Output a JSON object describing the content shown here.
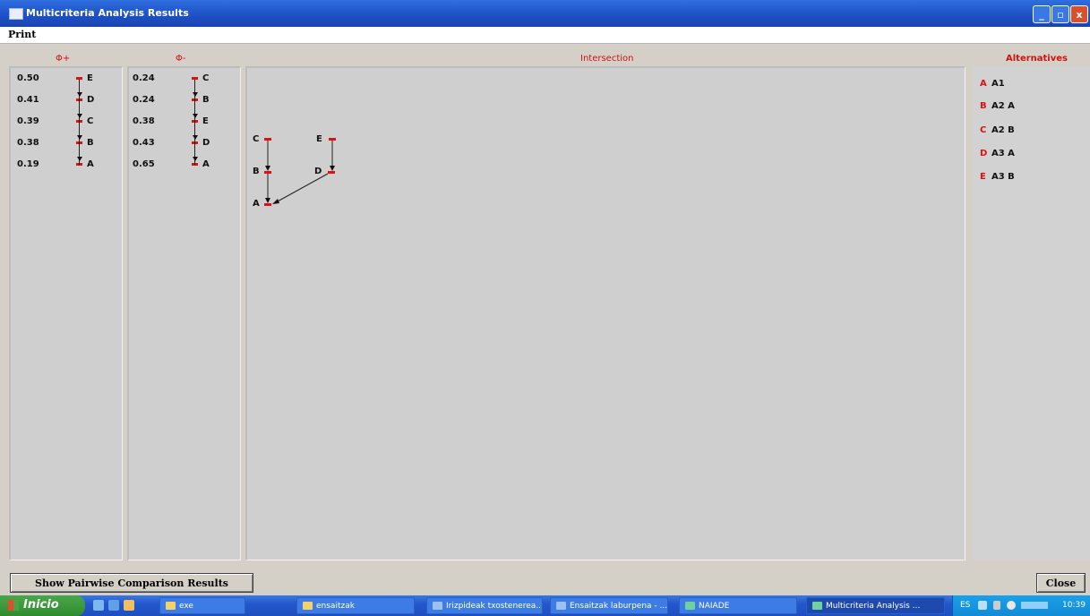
{
  "window": {
    "title": "Multicriteria Analysis Results",
    "min": "_",
    "max": "▫",
    "close": "x"
  },
  "menu": {
    "print": "Print"
  },
  "headers": {
    "phi_plus": "Φ+",
    "phi_minus": "Φ-",
    "intersection": "Intersection",
    "alternatives": "Alternatives"
  },
  "phi_plus": [
    {
      "value": "0.50",
      "label": "E"
    },
    {
      "value": "0.41",
      "label": "D"
    },
    {
      "value": "0.39",
      "label": "C"
    },
    {
      "value": "0.38",
      "label": "B"
    },
    {
      "value": "0.19",
      "label": "A"
    }
  ],
  "phi_minus": [
    {
      "value": "0.24",
      "label": "C"
    },
    {
      "value": "0.24",
      "label": "B"
    },
    {
      "value": "0.38",
      "label": "E"
    },
    {
      "value": "0.43",
      "label": "D"
    },
    {
      "value": "0.65",
      "label": "A"
    }
  ],
  "intersection": {
    "nodes": [
      "C",
      "E",
      "B",
      "D",
      "A"
    ]
  },
  "alternatives": [
    {
      "letter": "A",
      "name": "A1"
    },
    {
      "letter": "B",
      "name": "A2  A"
    },
    {
      "letter": "C",
      "name": "A2  B"
    },
    {
      "letter": "D",
      "name": "A3  A"
    },
    {
      "letter": "E",
      "name": "A3  B"
    }
  ],
  "buttons": {
    "pairwise": "Show Pairwise Comparison Results",
    "close": "Close"
  },
  "taskbar": {
    "start": "Inicio",
    "items": [
      "exe",
      "ensaitzak",
      "Irizpideak txostenerea...",
      "Ensaitzak laburpena - ...",
      "NAIADE",
      "Multicriteria Analysis ..."
    ],
    "tray_lang": "ES",
    "clock": "10:39"
  },
  "colors": {
    "accent_red": "#e01010",
    "titlebar_blue": "#1d4fc4",
    "panel_grey": "#cfcfcf"
  }
}
